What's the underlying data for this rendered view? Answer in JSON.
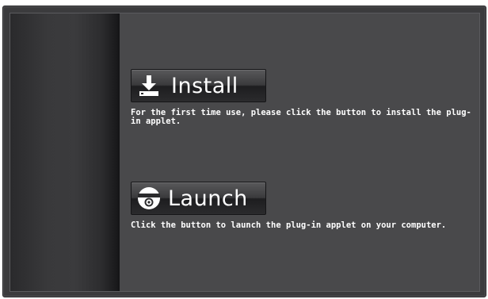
{
  "install": {
    "label": "Install",
    "description": "For the first time use, please click the button to install the plug-in applet.",
    "icon": "download-icon"
  },
  "launch": {
    "label": "Launch",
    "description": "Click the button to launch the plug-in applet on your computer.",
    "icon": "dome-camera-icon"
  },
  "colors": {
    "panel_background": "#49494b",
    "sidebar_dark": "#18181a",
    "text": "#ffffff"
  }
}
